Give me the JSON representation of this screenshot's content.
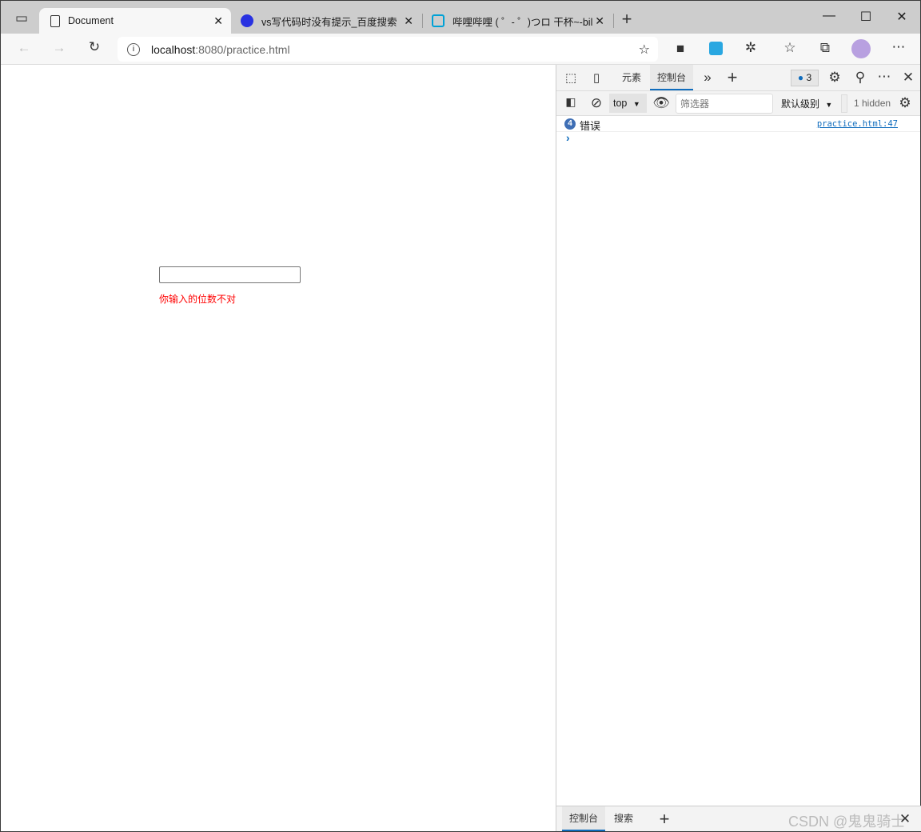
{
  "browser": {
    "tabs": [
      {
        "title": "Document",
        "icon": "page-icon",
        "active": true
      },
      {
        "title": "vs写代码时没有提示_百度搜索",
        "icon": "baidu-icon"
      },
      {
        "title": "哔哩哔哩 ( ゜- ゜)つロ 干杯~-bilil",
        "icon": "bilibili-icon"
      }
    ],
    "url_host": "localhost",
    "url_rest": ":8080/practice.html"
  },
  "page": {
    "input_value": "",
    "error_text": "你输入的位数不对",
    "error_color": "#ff0000"
  },
  "devtools": {
    "tabs": [
      "元素",
      "控制台"
    ],
    "active_tab": "控制台",
    "issues_count": "3",
    "context": "top",
    "filter_placeholder": "筛选器",
    "level": "默认级别",
    "hidden": "1 hidden",
    "messages": [
      {
        "count": "4",
        "text": "错误",
        "source": "practice.html:47"
      }
    ],
    "prompt": "›",
    "drawer_tabs": [
      "控制台",
      "搜索"
    ],
    "accent": "#0f6cbd"
  },
  "watermark": "CSDN @鬼鬼骑士"
}
